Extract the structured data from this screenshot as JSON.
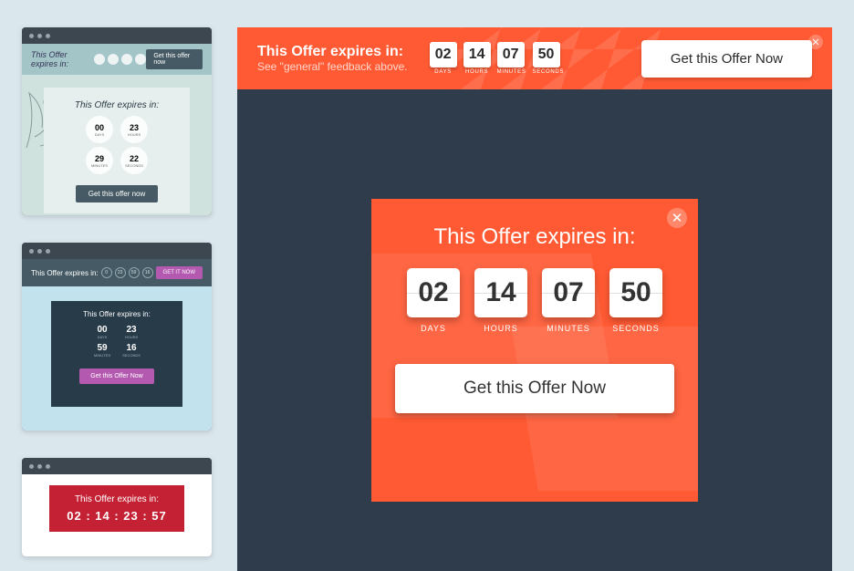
{
  "countdown": {
    "title": "This Offer expires in:",
    "sub": "See \"general\" feedback above.",
    "days": {
      "val": "02",
      "label": "DAYS"
    },
    "hours": {
      "val": "14",
      "label": "HOURS"
    },
    "minutes": {
      "val": "07",
      "label": "MINUTES"
    },
    "seconds": {
      "val": "50",
      "label": "SECONDS"
    },
    "cta": "Get this Offer Now"
  },
  "thumbs": {
    "t1": {
      "strip_title": "This Offer expires in:",
      "strip_btn": "Get this offer now",
      "card_title": "This Offer expires in:",
      "d": "00",
      "dlbl": "DAYS",
      "h": "23",
      "hlbl": "HOURS",
      "m": "29",
      "mlbl": "MINUTES",
      "s": "22",
      "slbl": "SECONDS",
      "btn": "Get this offer now"
    },
    "t2": {
      "strip_title": "This Offer expires in:",
      "strip_btn": "GET IT NOW",
      "card_title": "This Offer expires in:",
      "d": "00",
      "dlbl": "DAYS",
      "h": "23",
      "hlbl": "HOURS",
      "m": "59",
      "mlbl": "MINUTES",
      "s": "16",
      "slbl": "SECONDS",
      "btn": "Get this Offer Now"
    },
    "t3": {
      "title": "This Offer expires in:",
      "digits": "02 : 14 : 23 : 57"
    }
  }
}
